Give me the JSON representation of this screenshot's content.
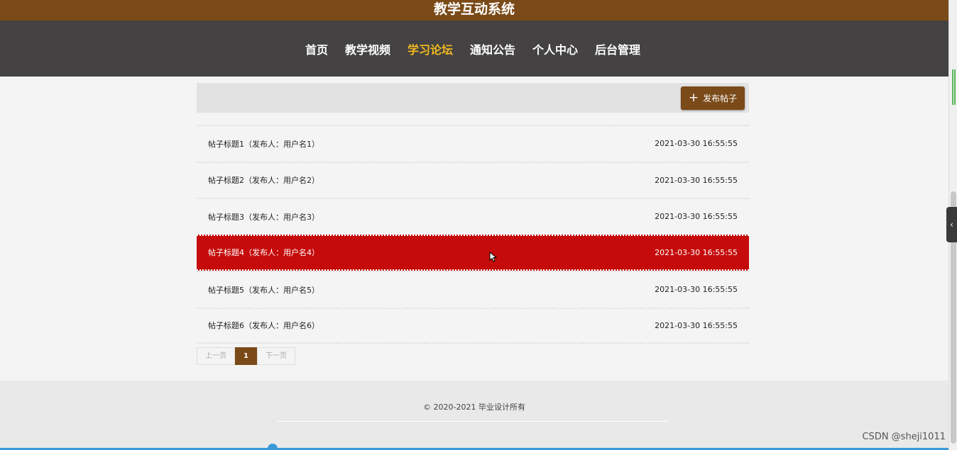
{
  "header": {
    "title": "教学互动系统"
  },
  "nav": {
    "items": [
      {
        "label": "首页"
      },
      {
        "label": "教学视频"
      },
      {
        "label": "学习论坛"
      },
      {
        "label": "通知公告"
      },
      {
        "label": "个人中心"
      },
      {
        "label": "后台管理"
      }
    ],
    "active_index": 2
  },
  "toolbar": {
    "publish_label": "发布帖子",
    "publish_icon": "plus-icon"
  },
  "posts": [
    {
      "title": "帖子标题1（发布人：用户名1）",
      "time": "2021-03-30 16:55:55"
    },
    {
      "title": "帖子标题2（发布人：用户名2）",
      "time": "2021-03-30 16:55:55"
    },
    {
      "title": "帖子标题3（发布人：用户名3）",
      "time": "2021-03-30 16:55:55"
    },
    {
      "title": "帖子标题4（发布人：用户名4）",
      "time": "2021-03-30 16:55:55"
    },
    {
      "title": "帖子标题5（发布人：用户名5）",
      "time": "2021-03-30 16:55:55"
    },
    {
      "title": "帖子标题6（发布人：用户名6）",
      "time": "2021-03-30 16:55:55"
    }
  ],
  "pager": {
    "prev_label": "上一页",
    "current_page": "1",
    "next_label": "下一页"
  },
  "footer": {
    "copyright": "© 2020-2021 毕业设计所有"
  },
  "watermark": "CSDN @sheji1011",
  "side_tab_icon": "chevron-left-icon",
  "colors": {
    "brand": "#7a4a18",
    "nav_bg": "#444242",
    "nav_active": "#f0b820",
    "row_highlight": "#c50b0b"
  }
}
